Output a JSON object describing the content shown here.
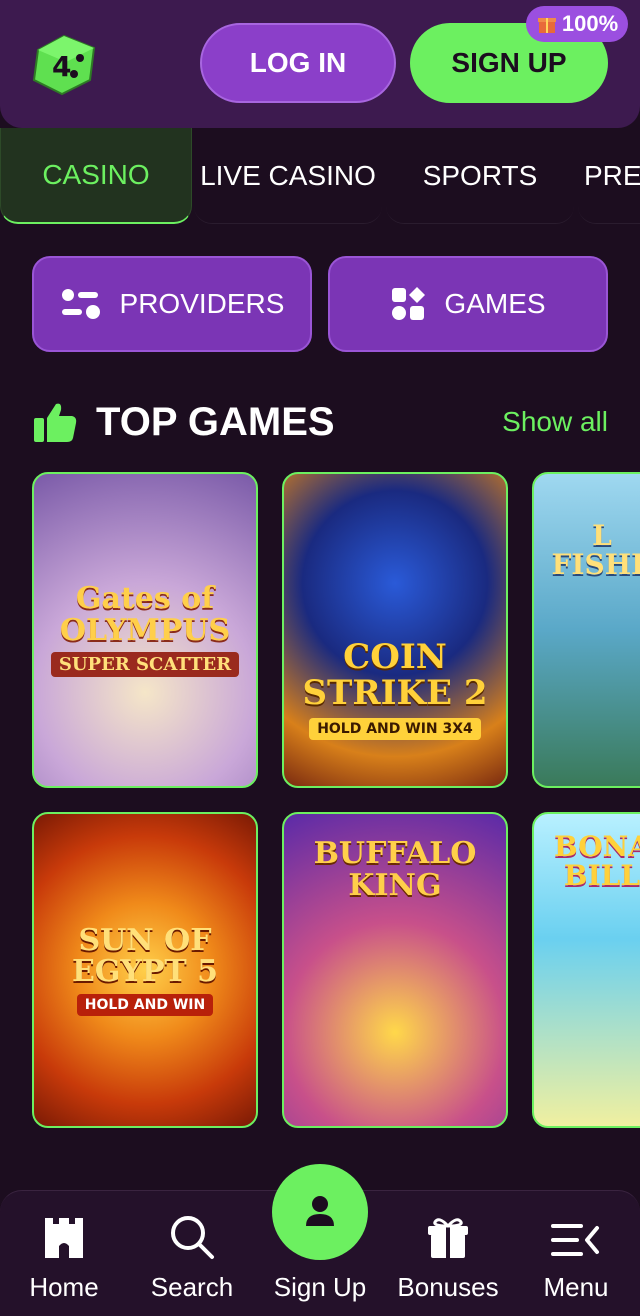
{
  "header": {
    "login_label": "LOG IN",
    "signup_label": "SIGN UP",
    "bonus_badge": "100%",
    "logo_icon": "dice-logo-icon"
  },
  "tabs": [
    {
      "label": "CASINO",
      "active": true
    },
    {
      "label": "LIVE CASINO",
      "active": false
    },
    {
      "label": "SPORTS",
      "active": false
    },
    {
      "label": "PRED",
      "active": false
    }
  ],
  "categories": {
    "providers_label": "PROVIDERS",
    "games_label": "GAMES"
  },
  "section": {
    "title": "TOP GAMES",
    "show_all": "Show all",
    "icon": "thumbs-up-icon"
  },
  "games": [
    {
      "line1": "Gates of OLYMPUS",
      "line2": "SUPER SCATTER",
      "line3": ""
    },
    {
      "line1": "COIN STRIKE 2",
      "line2": "",
      "line3": "HOLD AND WIN 3X4"
    },
    {
      "line1": "L FISHE",
      "line2": "",
      "line3": ""
    },
    {
      "line1": "SUN OF EGYPT 5",
      "line2": "",
      "line3": "HOLD AND WIN"
    },
    {
      "line1": "BUFFALO KING",
      "line2": "",
      "line3": ""
    },
    {
      "line1": "BONA BILL",
      "line2": "",
      "line3": ""
    }
  ],
  "bottom_nav": {
    "home": "Home",
    "search": "Search",
    "signup": "Sign Up",
    "bonuses": "Bonuses",
    "menu": "Menu"
  },
  "colors": {
    "accent_green": "#6cf060",
    "accent_purple": "#7b35b5",
    "background": "#1c0d1f"
  }
}
